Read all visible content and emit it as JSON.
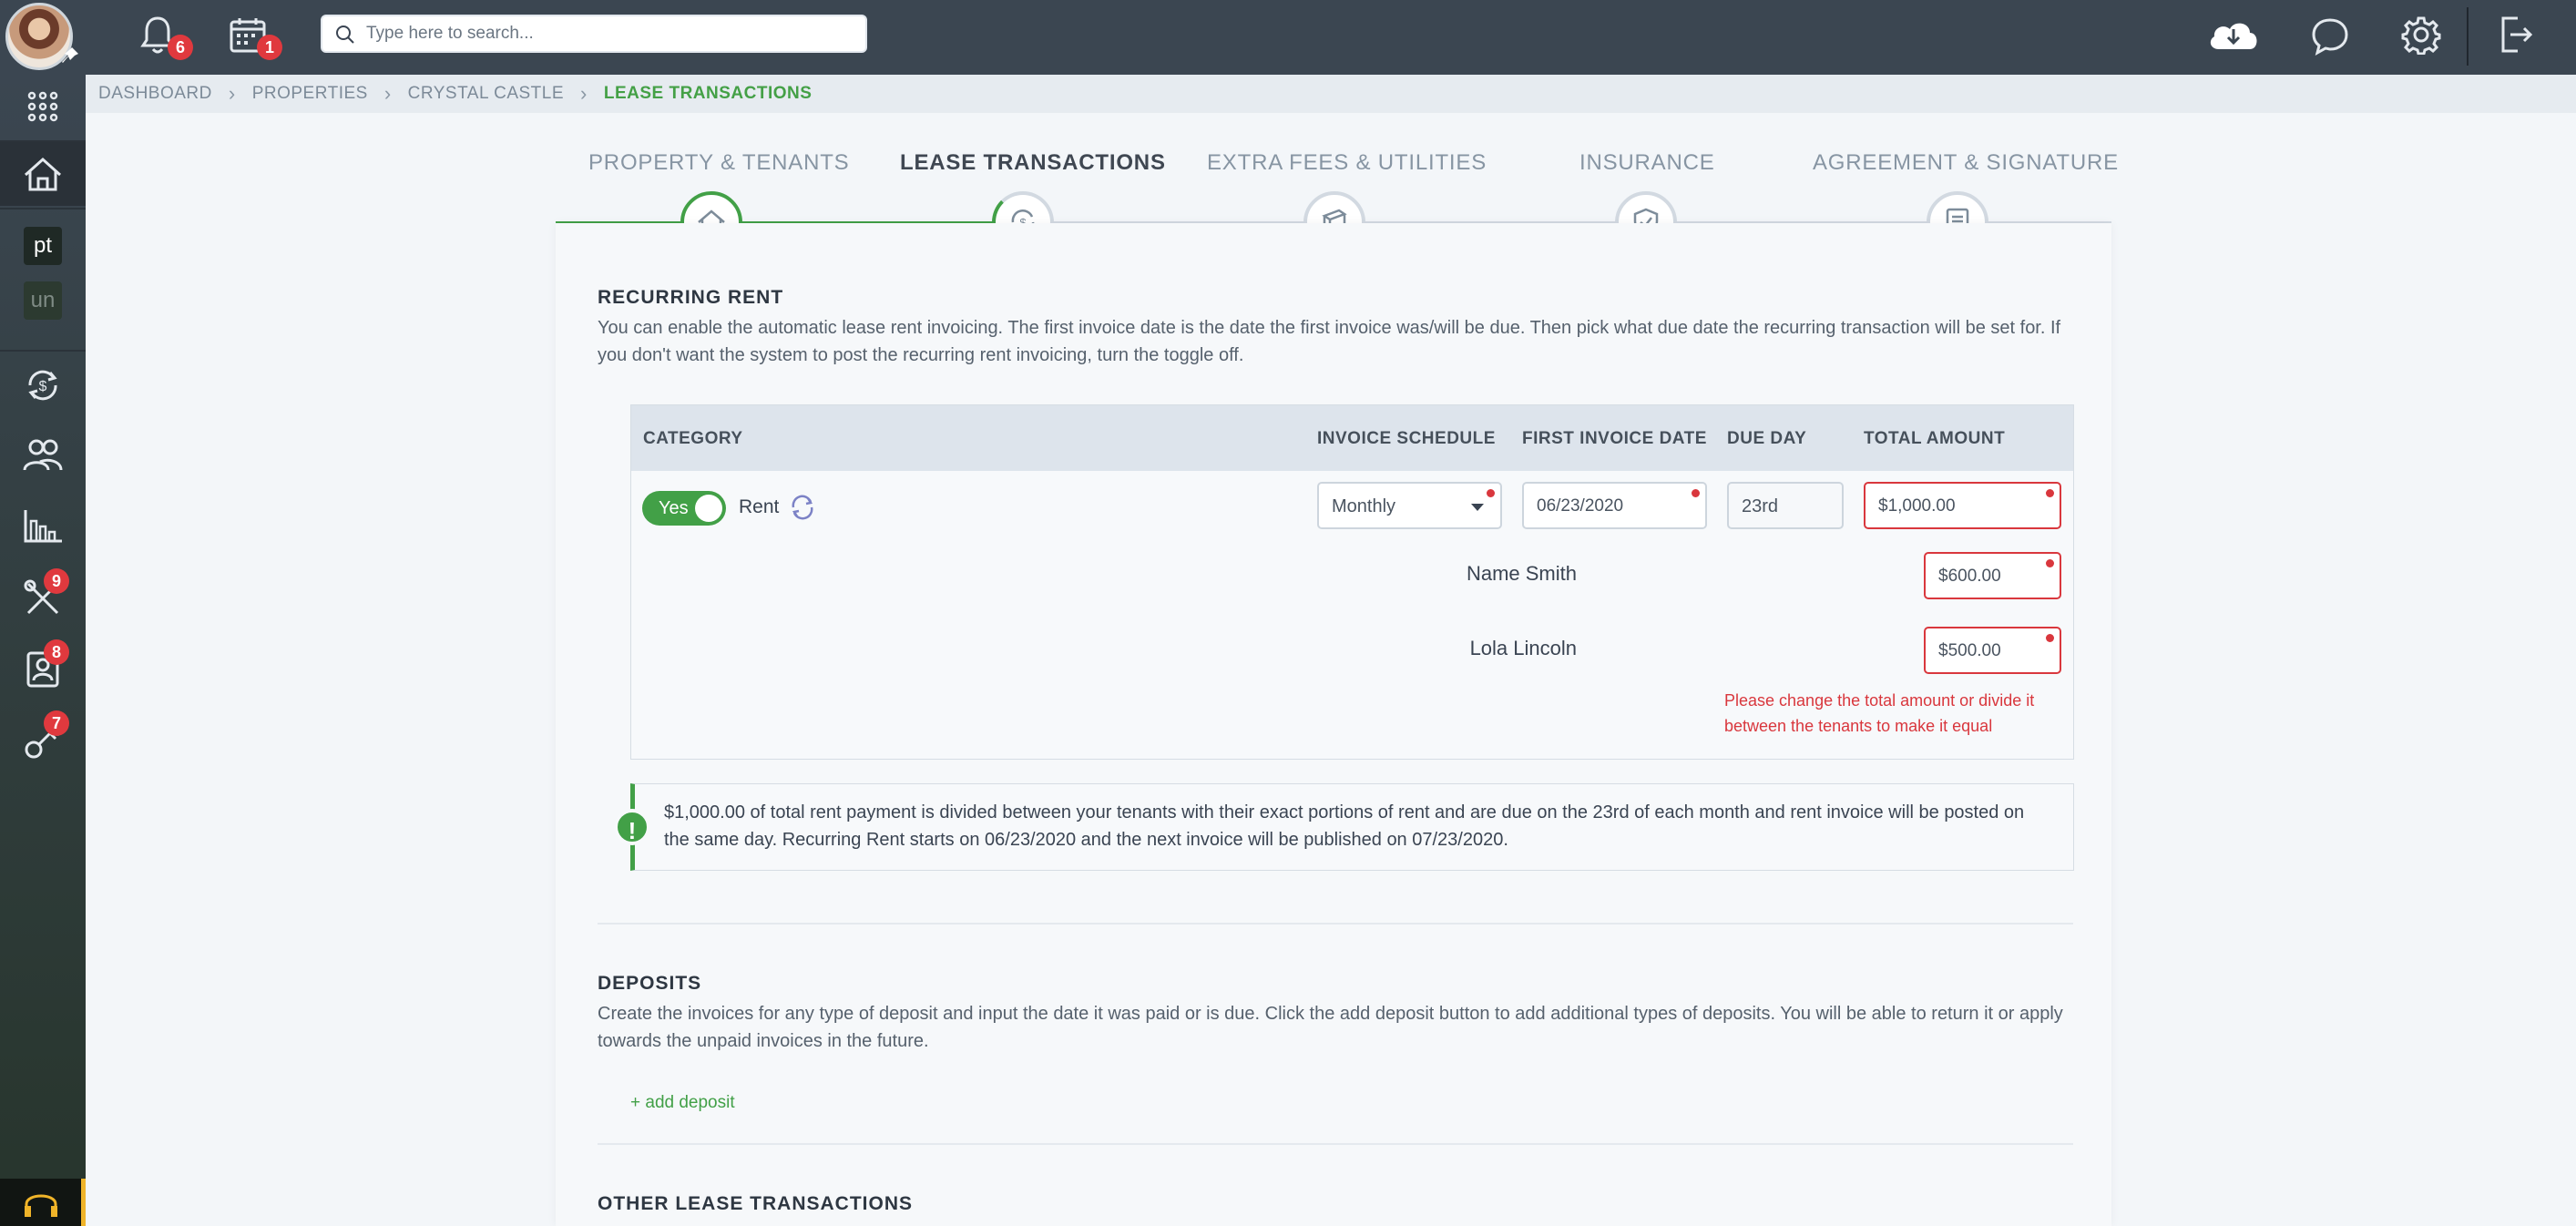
{
  "topbar": {
    "notifications_count": "6",
    "calendar_count": "1",
    "search_placeholder": "Type here to search..."
  },
  "sidebar": {
    "tags": [
      "pt",
      "un"
    ],
    "badges": {
      "tools": "9",
      "contacts": "8",
      "keys": "7"
    }
  },
  "breadcrumb": [
    "DASHBOARD",
    "PROPERTIES",
    "CRYSTAL CASTLE",
    "LEASE TRANSACTIONS"
  ],
  "steps": [
    {
      "label": "PROPERTY & TENANTS",
      "icon": "house-icon",
      "state": "done"
    },
    {
      "label": "LEASE TRANSACTIONS",
      "icon": "dollar-cycle-icon",
      "state": "current"
    },
    {
      "label": "EXTRA FEES & UTILITIES",
      "icon": "cash-stack-icon",
      "state": "pending"
    },
    {
      "label": "INSURANCE",
      "icon": "shield-icon",
      "state": "pending"
    },
    {
      "label": "AGREEMENT & SIGNATURE",
      "icon": "document-icon",
      "state": "pending"
    }
  ],
  "recurring": {
    "title": "RECURRING RENT",
    "description": "You can enable the automatic lease rent invoicing. The first invoice date is the date the first invoice was/will be due. Then pick what due date the recurring transaction will be set for. If you don't want the system to post the recurring rent invoicing, turn the toggle off.",
    "headers": {
      "category": "CATEGORY",
      "schedule": "INVOICE SCHEDULE",
      "first_date": "FIRST INVOICE DATE",
      "due_day": "DUE DAY",
      "total": "TOTAL AMOUNT"
    },
    "toggle_label": "Yes",
    "category": "Rent",
    "schedule": "Monthly",
    "first_date": "06/23/2020",
    "due_day": "23rd",
    "total": "$1,000.00",
    "tenants": [
      {
        "name": "Name Smith",
        "amount": "$600.00"
      },
      {
        "name": "Lola Lincoln",
        "amount": "$500.00"
      }
    ],
    "error": "Please change the total amount or divide it between the tenants to make it equal",
    "info": "$1,000.00 of total rent payment is divided between your tenants with their exact portions of rent and are due on the 23rd of each month and rent invoice will be posted on the same day. Recurring Rent starts on 06/23/2020 and the next invoice will be published on 07/23/2020."
  },
  "deposits": {
    "title": "DEPOSITS",
    "description": "Create the invoices for any type of deposit and input the date it was paid or is due. Click the add deposit button to add additional types of deposits. You will be able to return it or apply towards the unpaid invoices in the future.",
    "add_label": "+ add deposit"
  },
  "other": {
    "title": "OTHER LEASE TRANSACTIONS"
  },
  "colors": {
    "accent": "#42a047",
    "error": "#d9373d",
    "topbar": "#3b4651"
  }
}
